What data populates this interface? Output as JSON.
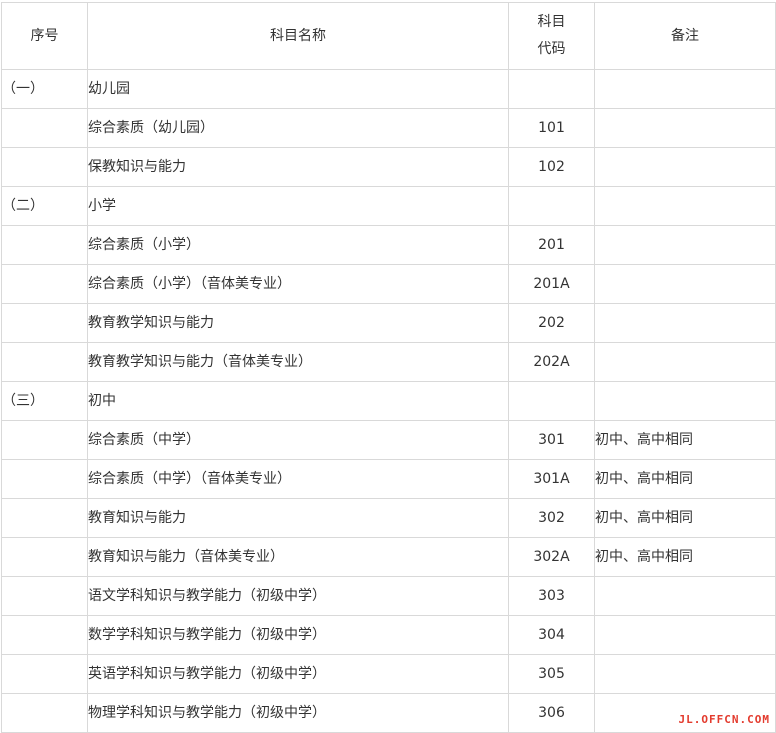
{
  "table": {
    "headers": {
      "seq": "序号",
      "name": "科目名称",
      "code_line1": "科目",
      "code_line2": "代码",
      "note": "备注"
    },
    "rows": [
      {
        "seq": "（一）",
        "name": "幼儿园",
        "code": "",
        "note": ""
      },
      {
        "seq": "",
        "name": "综合素质（幼儿园）",
        "code": "101",
        "note": ""
      },
      {
        "seq": "",
        "name": "保教知识与能力",
        "code": "102",
        "note": ""
      },
      {
        "seq": "（二）",
        "name": "小学",
        "code": "",
        "note": ""
      },
      {
        "seq": "",
        "name": "综合素质（小学）",
        "code": "201",
        "note": ""
      },
      {
        "seq": "",
        "name": "综合素质（小学）（音体美专业）",
        "code": "201A",
        "note": ""
      },
      {
        "seq": "",
        "name": "教育教学知识与能力",
        "code": "202",
        "note": ""
      },
      {
        "seq": "",
        "name": "教育教学知识与能力（音体美专业）",
        "code": "202A",
        "note": ""
      },
      {
        "seq": "（三）",
        "name": "初中",
        "code": "",
        "note": ""
      },
      {
        "seq": "",
        "name": "综合素质（中学）",
        "code": "301",
        "note": "初中、高中相同"
      },
      {
        "seq": "",
        "name": "综合素质（中学）（音体美专业）",
        "code": "301A",
        "note": "初中、高中相同"
      },
      {
        "seq": "",
        "name": "教育知识与能力",
        "code": "302",
        "note": "初中、高中相同"
      },
      {
        "seq": "",
        "name": "教育知识与能力（音体美专业）",
        "code": "302A",
        "note": "初中、高中相同"
      },
      {
        "seq": "",
        "name": "语文学科知识与教学能力（初级中学）",
        "code": "303",
        "note": ""
      },
      {
        "seq": "",
        "name": "数学学科知识与教学能力（初级中学）",
        "code": "304",
        "note": ""
      },
      {
        "seq": "",
        "name": "英语学科知识与教学能力（初级中学）",
        "code": "305",
        "note": ""
      },
      {
        "seq": "",
        "name": "物理学科知识与教学能力（初级中学）",
        "code": "306",
        "note": ""
      }
    ]
  },
  "watermark": "JL.OFFCN.COM"
}
